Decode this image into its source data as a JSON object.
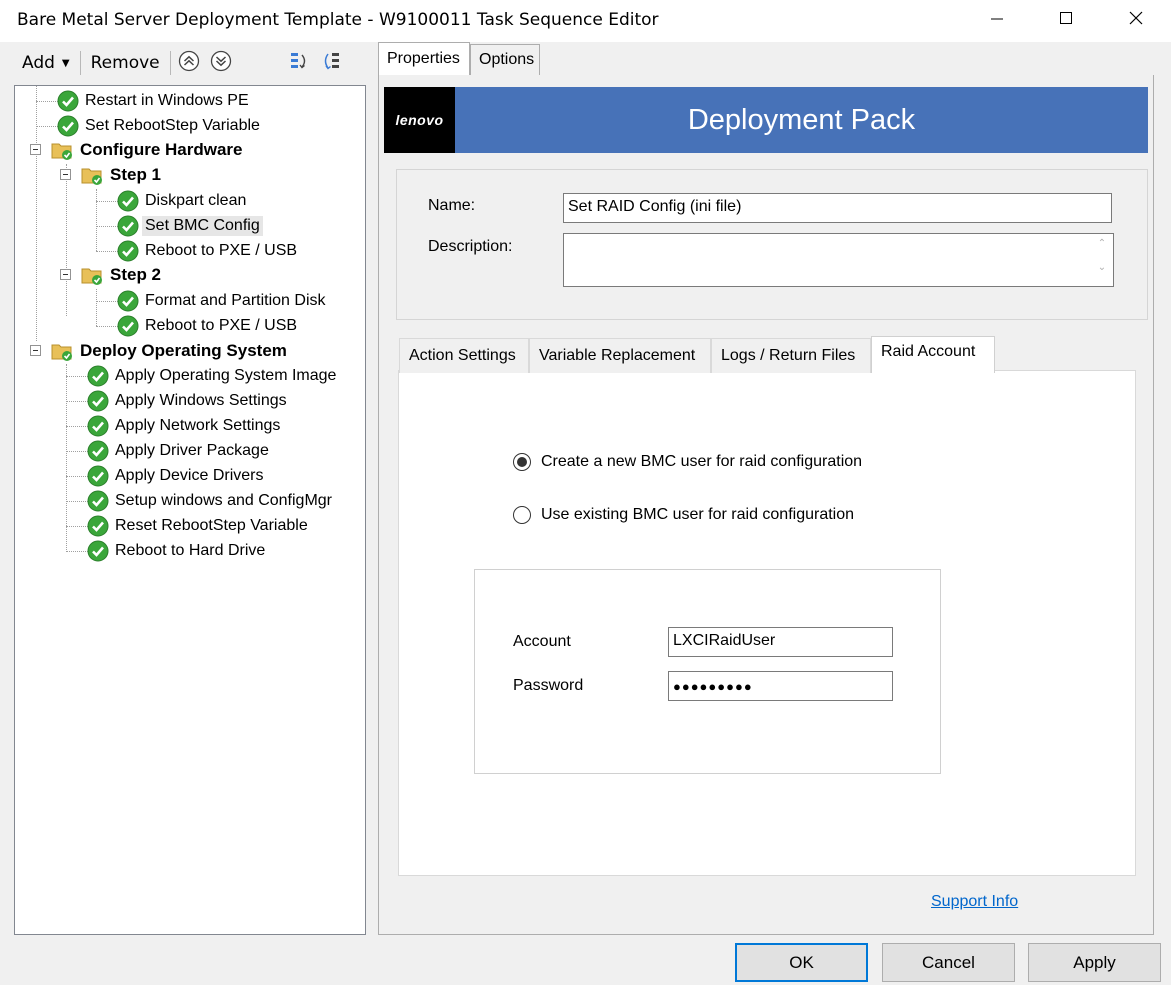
{
  "window": {
    "title": "Bare Metal Server Deployment Template - W9100011 Task Sequence Editor",
    "icons": {
      "minimize": "minimize-icon",
      "maximize": "maximize-icon",
      "close": "close-icon"
    }
  },
  "toolbar": {
    "add_label": "Add",
    "remove_label": "Remove",
    "icons": [
      "move-up-icon",
      "move-down-icon",
      "expand-collapse-icon",
      "sort-icon"
    ]
  },
  "tree": {
    "items": [
      {
        "label": "Restart in Windows PE",
        "type": "step",
        "level": 1
      },
      {
        "label": "Set RebootStep Variable",
        "type": "step",
        "level": 1
      },
      {
        "label": "Configure Hardware",
        "type": "group",
        "level": 0
      },
      {
        "label": "Step 1",
        "type": "group",
        "level": 1
      },
      {
        "label": "Diskpart clean",
        "type": "step",
        "level": 2
      },
      {
        "label": "Set BMC Config",
        "type": "step",
        "level": 2,
        "selected": true
      },
      {
        "label": "Reboot to PXE / USB",
        "type": "step",
        "level": 2
      },
      {
        "label": "Step 2",
        "type": "group",
        "level": 1
      },
      {
        "label": "Format and Partition Disk",
        "type": "step",
        "level": 2
      },
      {
        "label": "Reboot to PXE / USB",
        "type": "step",
        "level": 2
      },
      {
        "label": "Deploy Operating System",
        "type": "group",
        "level": 0
      },
      {
        "label": "Apply Operating System Image",
        "type": "step",
        "level": 1
      },
      {
        "label": "Apply Windows Settings",
        "type": "step",
        "level": 1
      },
      {
        "label": "Apply Network Settings",
        "type": "step",
        "level": 1
      },
      {
        "label": "Apply Driver Package",
        "type": "step",
        "level": 1
      },
      {
        "label": "Apply Device Drivers",
        "type": "step",
        "level": 1
      },
      {
        "label": "Setup windows and ConfigMgr",
        "type": "step",
        "level": 1
      },
      {
        "label": "Reset RebootStep Variable",
        "type": "step",
        "level": 1
      },
      {
        "label": "Reboot to Hard Drive",
        "type": "step",
        "level": 1
      }
    ]
  },
  "tabs": {
    "properties": "Properties",
    "options": "Options",
    "active": "Properties"
  },
  "banner": {
    "logo": "lenovo",
    "title": "Deployment Pack",
    "color": "#4772b8"
  },
  "form": {
    "name_label": "Name:",
    "name_value": "Set RAID Config (ini file)",
    "description_label": "Description:",
    "description_value": ""
  },
  "subtabs": {
    "items": [
      "Action Settings",
      "Variable Replacement",
      "Logs / Return Files",
      "Raid Account"
    ],
    "active": "Raid Account"
  },
  "raid": {
    "option_new": "Create a new BMC user for raid configuration",
    "option_existing": "Use existing BMC user for raid configuration",
    "selected": "new",
    "account_label": "Account",
    "account_value": "LXCIRaidUser",
    "password_label": "Password",
    "password_value": "●●●●●●●●●"
  },
  "support_link": "Support Info",
  "buttons": {
    "ok": "OK",
    "cancel": "Cancel",
    "apply": "Apply"
  },
  "colors": {
    "check_green": "#3aa63a",
    "folder_yellow": "#e8c058",
    "link": "#0066cc",
    "accent": "#0078d7"
  }
}
